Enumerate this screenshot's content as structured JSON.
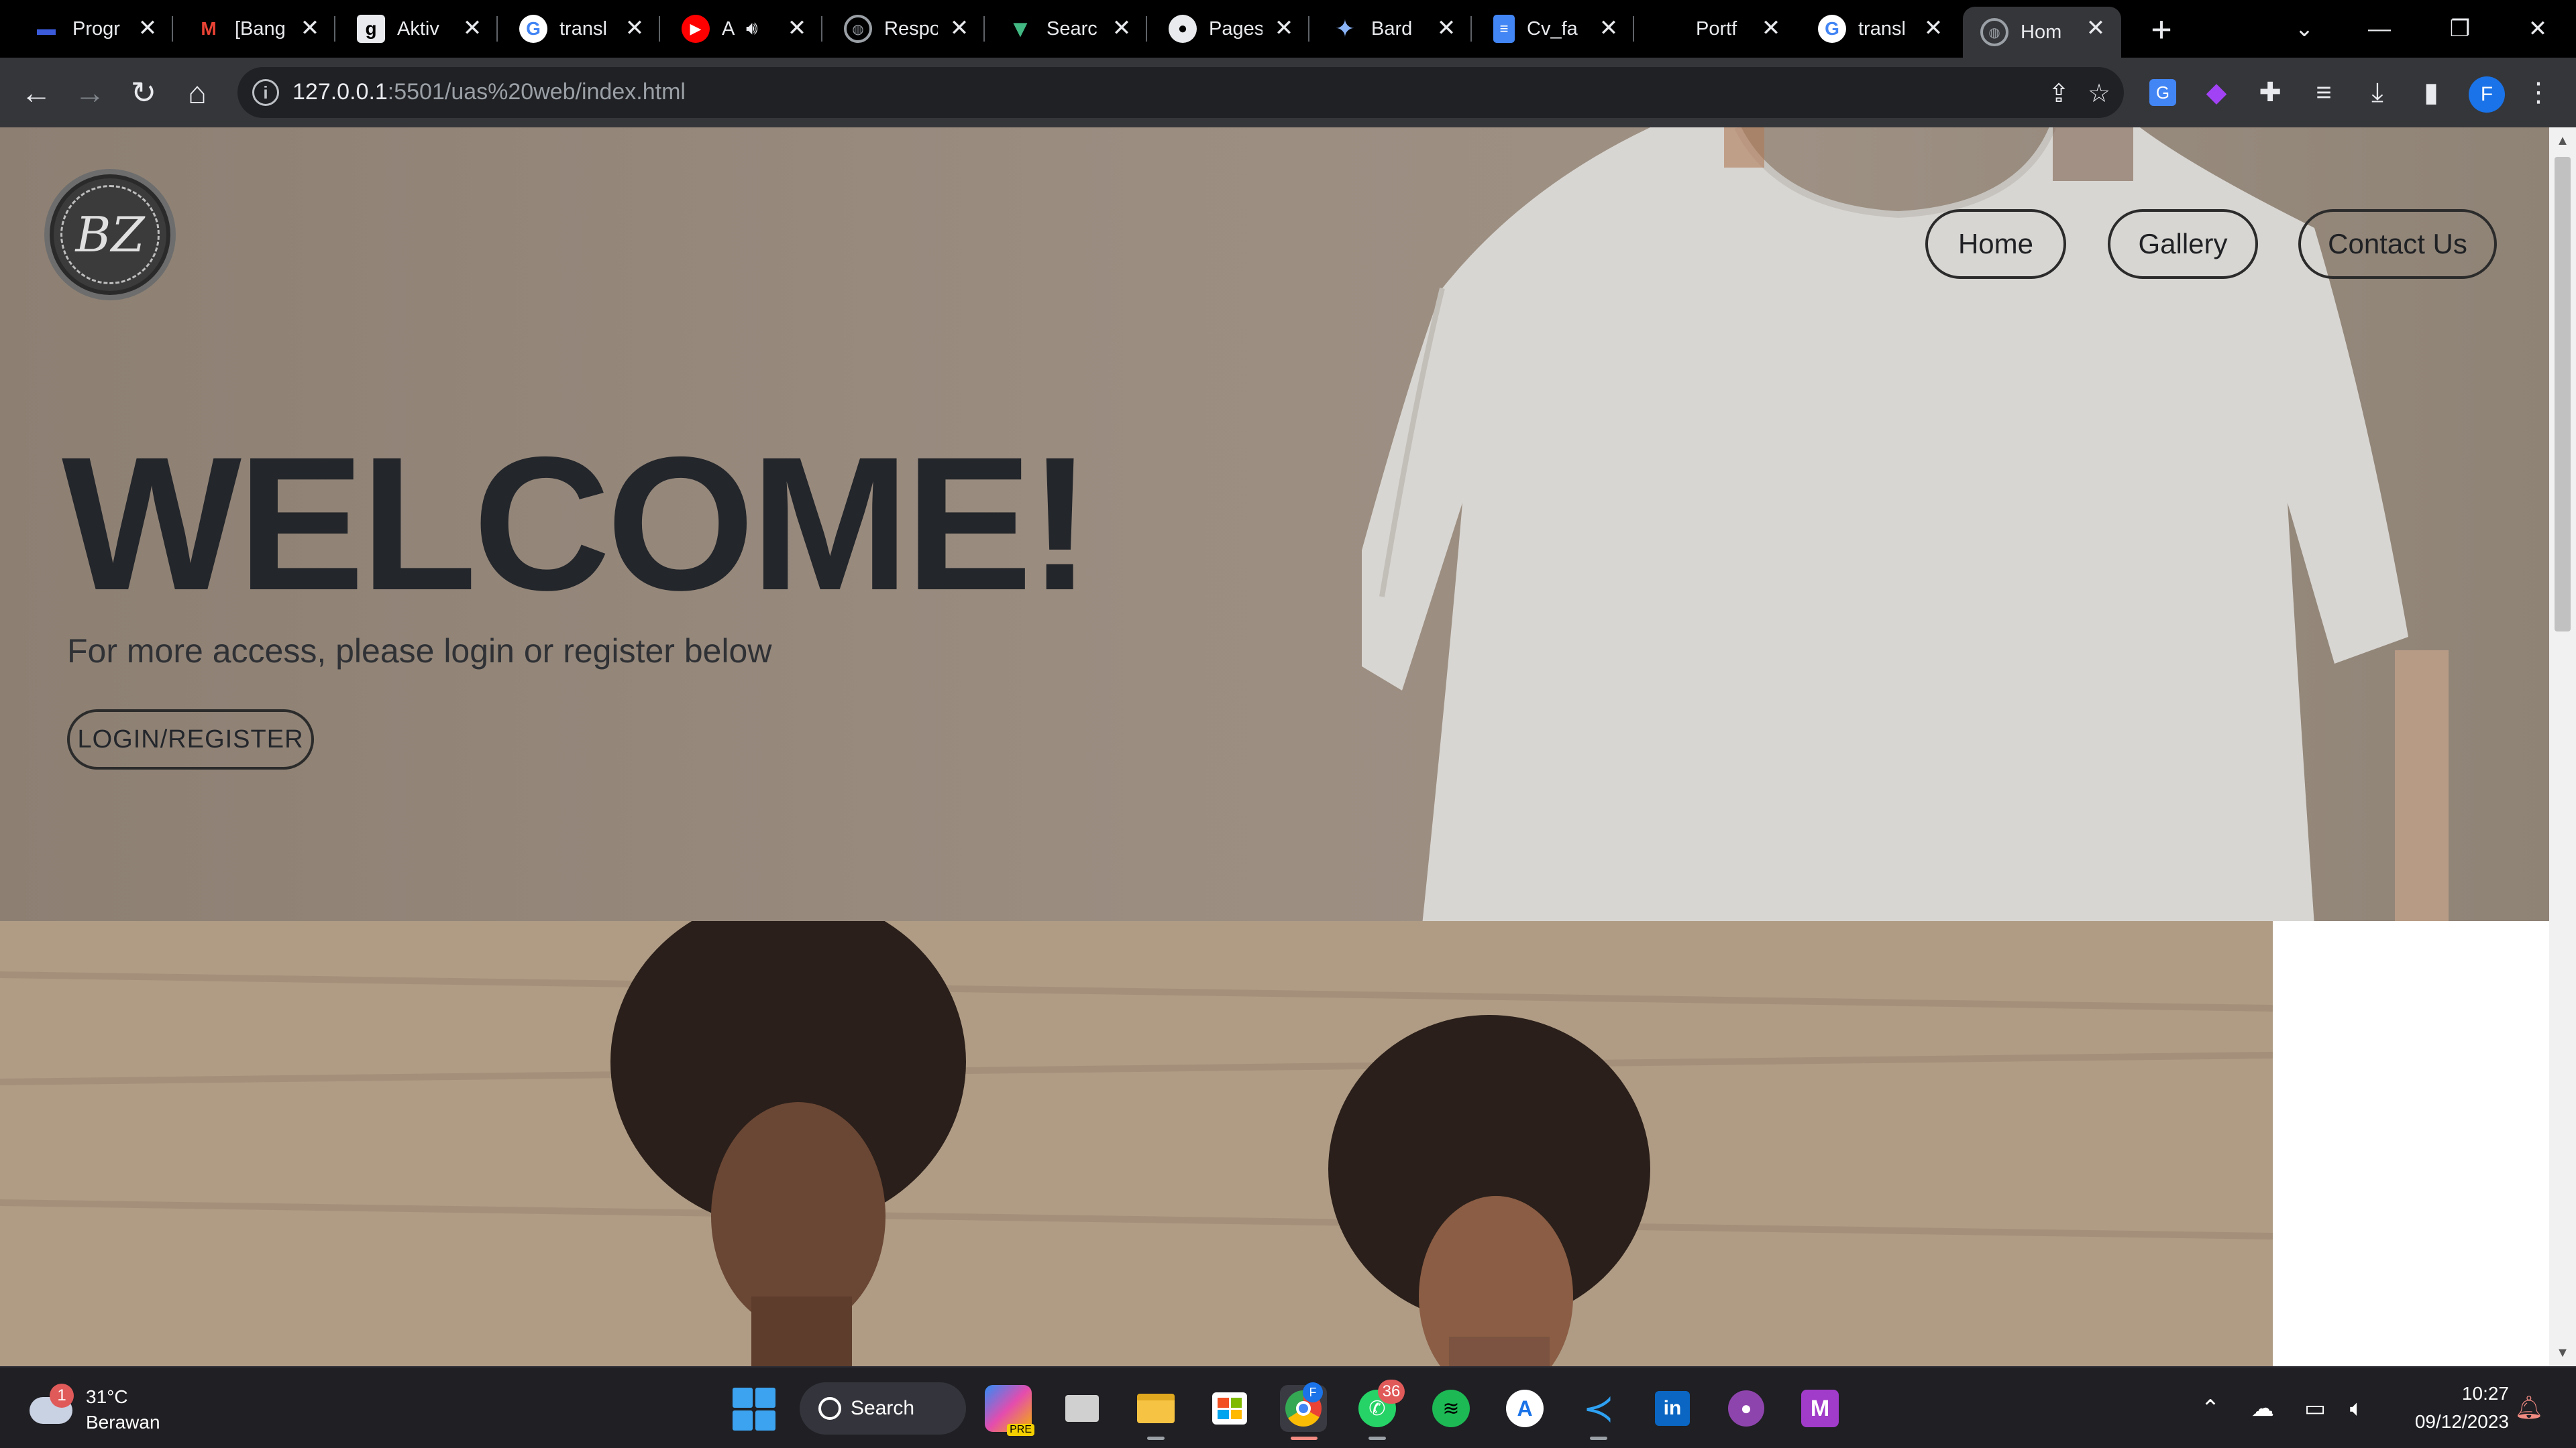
{
  "browser": {
    "tabs": [
      {
        "title": "Progr",
        "icon": "progress-icon",
        "color": "#3b5bdb"
      },
      {
        "title": "[Bang",
        "icon": "gmail-icon",
        "color": "#ea4335"
      },
      {
        "title": "Aktiv",
        "icon": "g-letter-icon",
        "color": "#e8eaed"
      },
      {
        "title": "transl",
        "icon": "google-icon",
        "color": "#4285f4"
      },
      {
        "title": "A",
        "icon": "youtube-music-icon",
        "color": "#ff0000"
      },
      {
        "title": "Respo",
        "icon": "globe-icon",
        "color": "#9aa0a6"
      },
      {
        "title": "Searc",
        "icon": "vue-icon",
        "color": "#42b883"
      },
      {
        "title": "Pages",
        "icon": "github-icon",
        "color": "#e8eaed"
      },
      {
        "title": "Bard",
        "icon": "bard-sparkle-icon",
        "color": "#8ab4f8"
      },
      {
        "title": "Cv_fa",
        "icon": "google-docs-icon",
        "color": "#4285f4"
      },
      {
        "title": "Portf",
        "icon": "blank-icon",
        "color": "#000000"
      },
      {
        "title": "transl",
        "icon": "google-icon",
        "color": "#4285f4"
      },
      {
        "title": "Hom",
        "icon": "globe-icon",
        "color": "#9aa0a6",
        "active": true
      }
    ],
    "url_host": "127.0.0.1",
    "url_path": ":5501/uas%20web/index.html",
    "profile_initial": "F"
  },
  "site": {
    "logo_text": "BZ",
    "nav": [
      "Home",
      "Gallery",
      "Contact Us"
    ],
    "hero_title": "WELCOME!",
    "hero_subtitle": "For more access, please login or register below",
    "cta_label": "LOGIN/REGISTER"
  },
  "taskbar": {
    "weather_temp": "31°C",
    "weather_condition": "Berawan",
    "weather_badge": "1",
    "search_label": "Search",
    "copilot_badge": "PRE",
    "whatsapp_badge": "36",
    "chrome_badge": "F",
    "time": "10:27",
    "date": "09/12/2023"
  },
  "colors": {
    "hero_text": "#23262b",
    "accent": "#1a73e8"
  }
}
